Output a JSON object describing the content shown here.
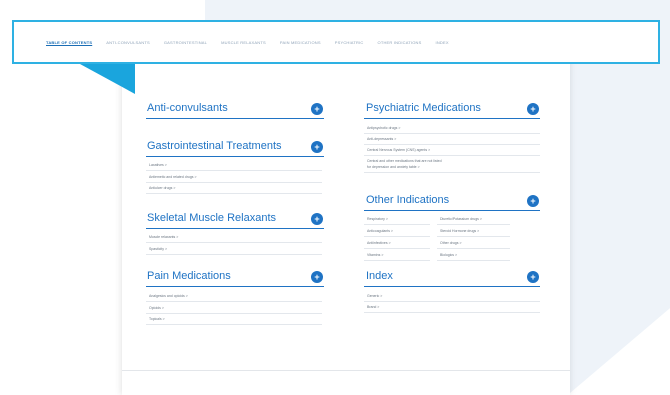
{
  "nav": {
    "items": [
      {
        "label": "TABLE OF CONTENTS",
        "active": true
      },
      {
        "label": "ANTI-CONVULSANTS",
        "active": false
      },
      {
        "label": "GASTROINTESTINAL",
        "active": false
      },
      {
        "label": "MUSCLE RELAXANTS",
        "active": false
      },
      {
        "label": "PAIN MEDICATIONS",
        "active": false
      },
      {
        "label": "PSYCHIATRIC",
        "active": false
      },
      {
        "label": "OTHER INDICATIONS",
        "active": false
      },
      {
        "label": "INDEX",
        "active": false
      }
    ]
  },
  "left": {
    "anticonvulsants": {
      "title": "Anti-convulsants"
    },
    "gastro": {
      "title": "Gastrointestinal Treatments",
      "items": [
        "Laxatives  >",
        "Antiemetic and related drugs  >",
        "Antiulcer drugs  >"
      ]
    },
    "skeletal": {
      "title": "Skeletal Muscle Relaxants",
      "items": [
        "Muscle relaxants  >",
        "Spasticity  >"
      ]
    },
    "pain": {
      "title": "Pain Medications",
      "items": [
        "Analgesics and opioids  >",
        "Opioids  >",
        "Topicals  >"
      ]
    }
  },
  "right": {
    "psychiatric": {
      "title": "Psychiatric Medications",
      "items": [
        "Antipsychotic drugs  >",
        "Anti-depressants  >",
        "Central Nervous System (CNS) agents  >",
        "Central and other medications that are not listed",
        "for depression and anxiety table  >"
      ]
    },
    "other": {
      "title": "Other Indications",
      "col1": [
        "Respiratory  >",
        "Anticoagulants  >",
        "Antiinfectives  >",
        "Vitamins  >"
      ],
      "col2": [
        "Diuretic/Potassium drugs  >",
        "Steroid Hormone drugs  >",
        "Other drugs  >",
        "Biologics  >"
      ]
    },
    "index": {
      "title": "Index",
      "items": [
        "Generic  >",
        "Brand  >"
      ]
    }
  },
  "toggle_symbol": "+"
}
